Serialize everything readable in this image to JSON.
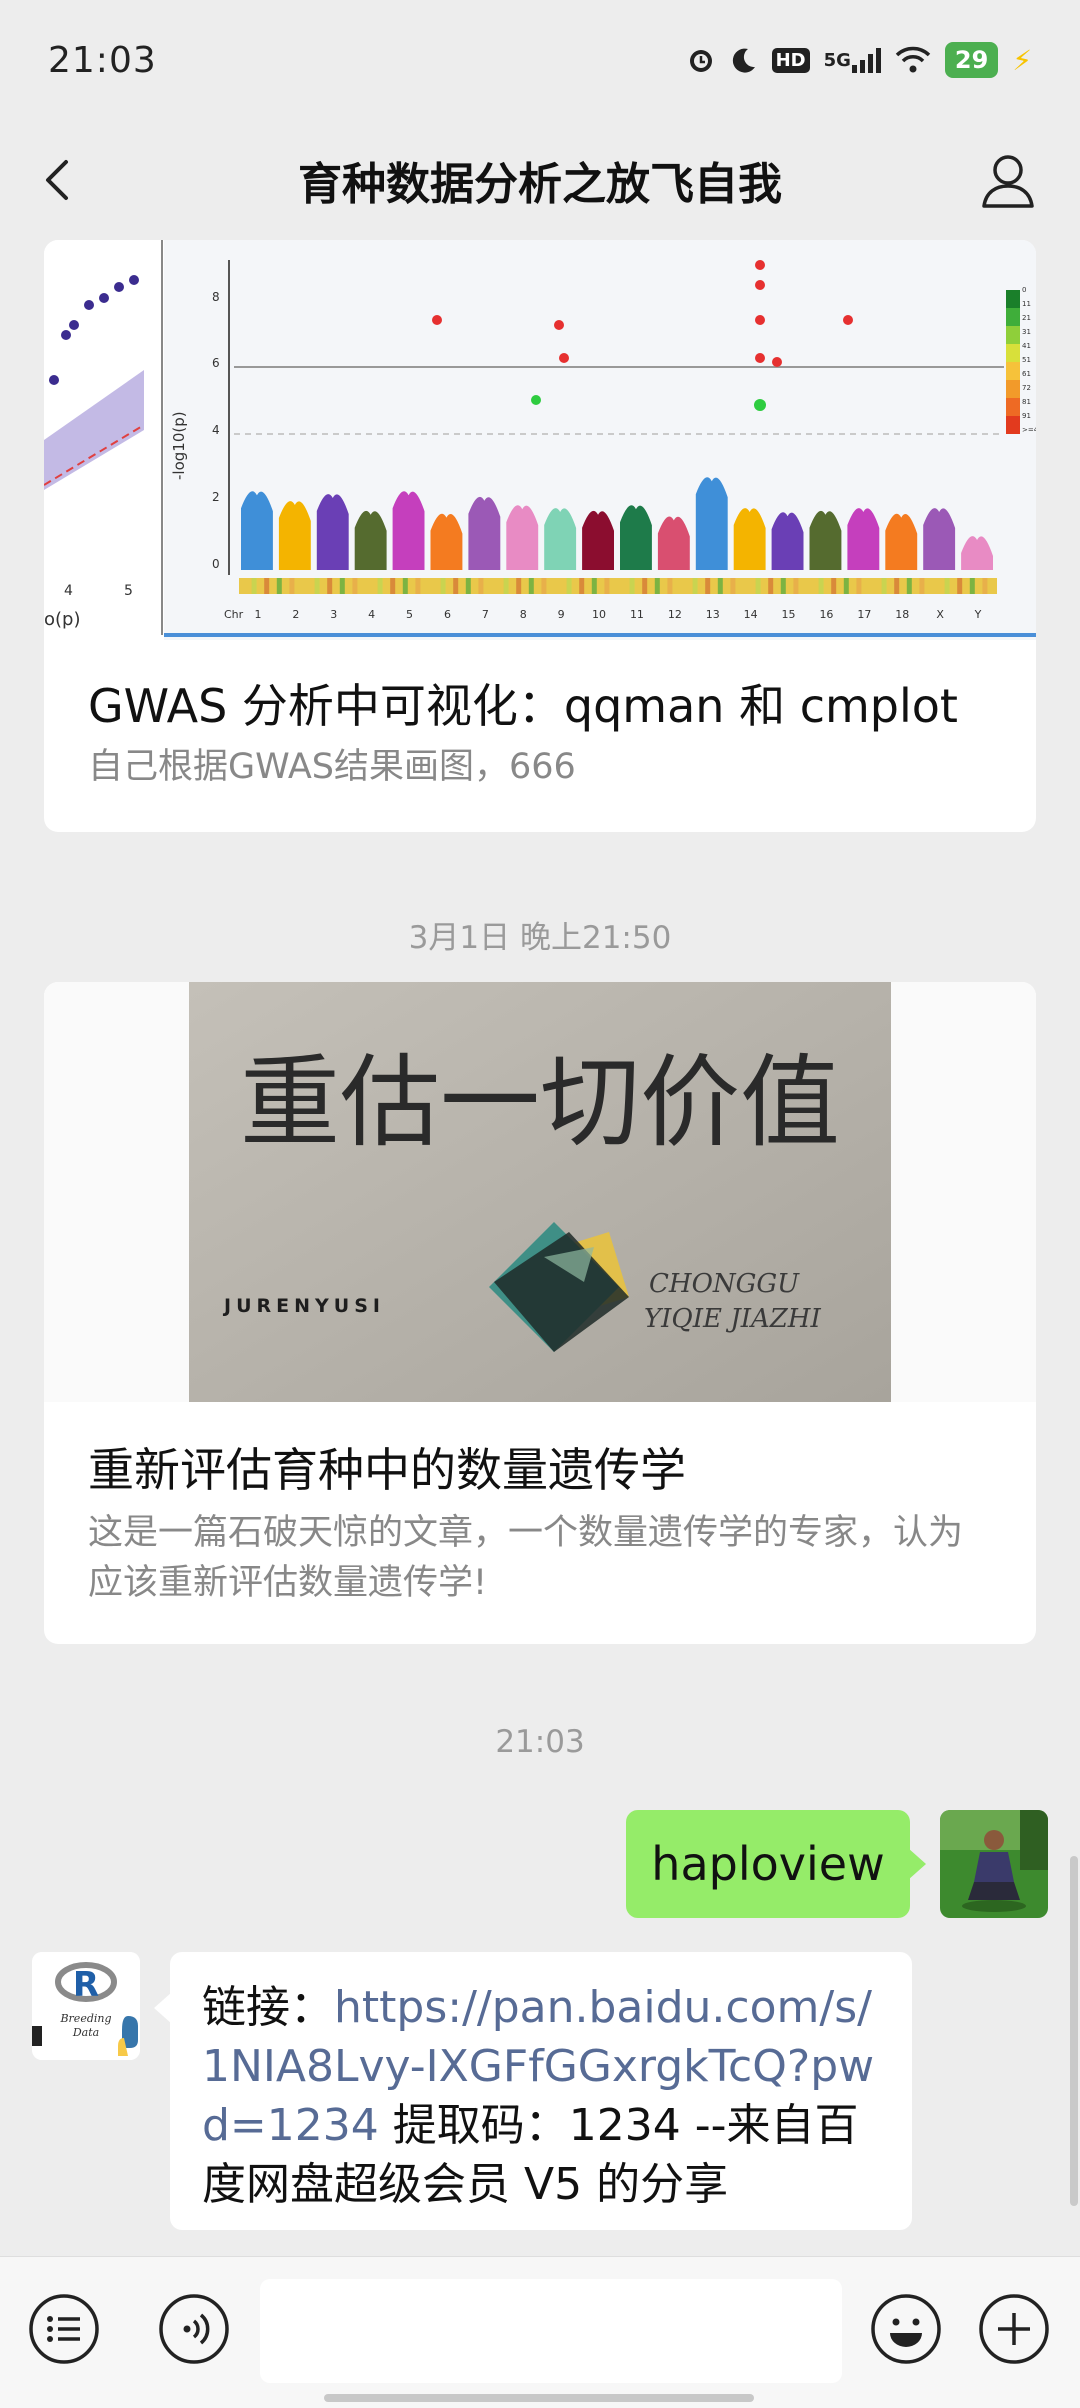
{
  "status_bar": {
    "time": "21:03",
    "hd": "HD",
    "network": "5G",
    "battery": "29"
  },
  "nav": {
    "title": "育种数据分析之放飞自我"
  },
  "articles": [
    {
      "title": "GWAS 分析中可视化：qqman 和 cmplot",
      "description": "自己根据GWAS结果画图，666"
    },
    {
      "title": "重新评估育种中的数量遗传学",
      "description": "这是一篇石破天惊的文章，一个数量遗传学的专家，认为应该重新评估数量遗传学!"
    }
  ],
  "plot_image": {
    "ylabel": "-log10(p)",
    "qq_xlabel": "o(p)",
    "qq_ticks": [
      "4",
      "5"
    ],
    "y_ticks": [
      "8",
      "6",
      "4",
      "2",
      "0"
    ],
    "chr_label": "Chr",
    "chr_ticks": [
      "1",
      "2",
      "3",
      "4",
      "5",
      "6",
      "7",
      "8",
      "9",
      "10",
      "11",
      "12",
      "13",
      "14",
      "15",
      "16",
      "17",
      "18",
      "X",
      "Y"
    ],
    "legend_ticks": [
      "0",
      "11",
      "21",
      "31",
      "41",
      "51",
      "61",
      "72",
      "81",
      "91",
      ">=40"
    ],
    "colors": [
      "#3f8fd8",
      "#f4b400",
      "#6a3fb5",
      "#556b2f",
      "#c53fbd",
      "#f47b20",
      "#9b59b6",
      "#e88bc4",
      "#7fd3b5",
      "#8b0d2f",
      "#1e7b4a",
      "#d94f70"
    ]
  },
  "cover_image": {
    "main_text": "重估一切价值",
    "left_text": "JURENYUSI",
    "right_text_1": "CHONGGU",
    "right_text_2": "YIQIE JIAZHI"
  },
  "timestamps": [
    "3月1日 晚上21:50",
    "21:03"
  ],
  "messages": {
    "outgoing": "haploview",
    "incoming": {
      "prefix": "链接：",
      "link": "https://pan.baidu.com/s/1NIA8Lvy-IXGFfGGxrgkTcQ?pwd=1234",
      "suffix": " 提取码：1234 --来自百度网盘超级会员 V5 的分享"
    }
  },
  "avatar_logo": {
    "letter": "R",
    "line1": "Breeding",
    "line2": "Data"
  }
}
